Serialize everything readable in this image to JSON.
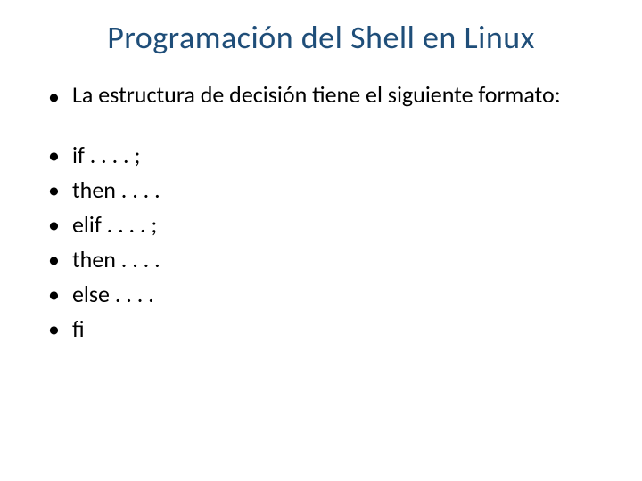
{
  "slide": {
    "title": "Programación del Shell en Linux",
    "intro": "La estructura de decisión tiene el siguiente formato:",
    "items": [
      "if . . . . ;",
      "then . . . .",
      "elif . . . . ;",
      "then . . . .",
      "else . . . .",
      "fi"
    ]
  }
}
